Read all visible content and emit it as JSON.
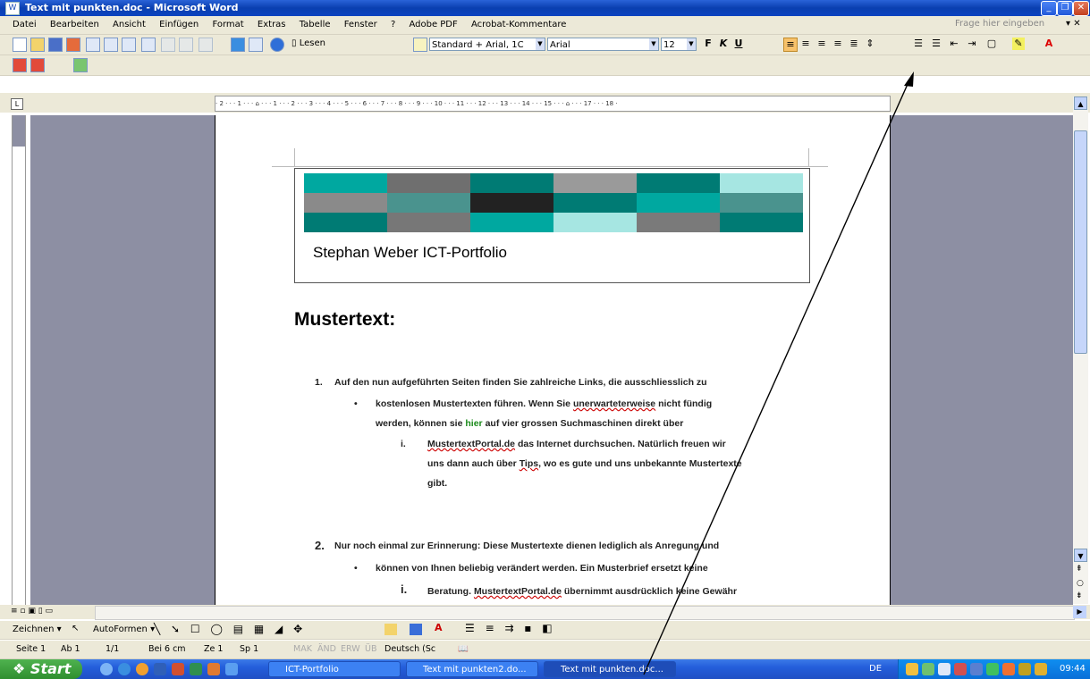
{
  "window": {
    "title": "Text mit punkten.doc - Microsoft Word",
    "app_icon": "W"
  },
  "menu": {
    "items": [
      "Datei",
      "Bearbeiten",
      "Ansicht",
      "Einfügen",
      "Format",
      "Extras",
      "Tabelle",
      "Fenster",
      "?",
      "Adobe PDF",
      "Acrobat-Kommentare"
    ],
    "help_placeholder": "Frage hier eingeben"
  },
  "toolbar": {
    "read_label": "Lesen",
    "style_value": "Standard + Arial, 1C",
    "font_value": "Arial",
    "size_value": "12",
    "bold": "F",
    "italic": "K",
    "underline": "U"
  },
  "ruler": {
    "ticks": "· 2 · · · 1 · · · ⌂ · · · 1 · · · 2 · · · 3 · · · 4 · · · 5 · · · 6 · · · 7 · · · 8 · · · 9 · · · 10 · · · 11 · · · 12 · · · 13 · · · 14 · · · 15 · · · ⌂ · · · 17 · · · 18 ·"
  },
  "document": {
    "banner_title": "Stephan Weber ICT-Portfolio",
    "heading": "Mustertext:",
    "list": {
      "n1": "1.",
      "p1": "Auf den nun aufgeführten Seiten finden Sie zahlreiche Links, die ausschliesslich zu",
      "b1a": "kostenlosen Mustertexten führen. Wenn Sie",
      "b1b": "unerwarteterweise",
      "b1c": "nicht fündig",
      "b2a": "werden, können sie",
      "b2b": "hier",
      "b2c": "auf vier grossen Suchmaschinen direkt über",
      "r1": "i.",
      "r1a": "MustertextPortal.de",
      "r1b": "das Internet durchsuchen. Natürlich freuen wir",
      "r2a": "uns dann auch über",
      "r2b": "Tips",
      "r2c": ", wo es gute und uns unbekannte Mustertexte",
      "r3": "gibt.",
      "n2": "2.",
      "p2": "Nur noch einmal zur Erinnerung: Diese Mustertexte dienen lediglich als Anregung und",
      "b3": "können von Ihnen beliebig verändert werden. Ein Musterbrief ersetzt keine",
      "r4": "i.",
      "r4a": "Beratung.",
      "r4b": "MustertextPortal.de",
      "r4c": "übernimmt ausdrücklich keine Gewähr"
    }
  },
  "drawing": {
    "zeichnen": "Zeichnen ▾",
    "autoformen": "AutoFormen ▾"
  },
  "status": {
    "seite": "Seite 1",
    "ab": "Ab 1",
    "pages": "1/1",
    "bei": "Bei 6 cm",
    "ze": "Ze 1",
    "sp": "Sp 1",
    "mak": "MAK",
    "aend": "ÄND",
    "erw": "ERW",
    "ueb": "ÜB",
    "lang": "Deutsch (Sc"
  },
  "taskbar": {
    "start": "Start",
    "tasks": [
      "ICT-Portfolio",
      "Text mit punkten2.do...",
      "Text mit punkten.doc..."
    ],
    "lang": "DE",
    "clock": "09:44"
  },
  "colors": {
    "teal_dark": "#007b74",
    "teal": "#00a8a0",
    "teal_light": "#a6e6e2",
    "teal_mid": "#4a938e",
    "workspace_grey": "#8d8fa3"
  }
}
